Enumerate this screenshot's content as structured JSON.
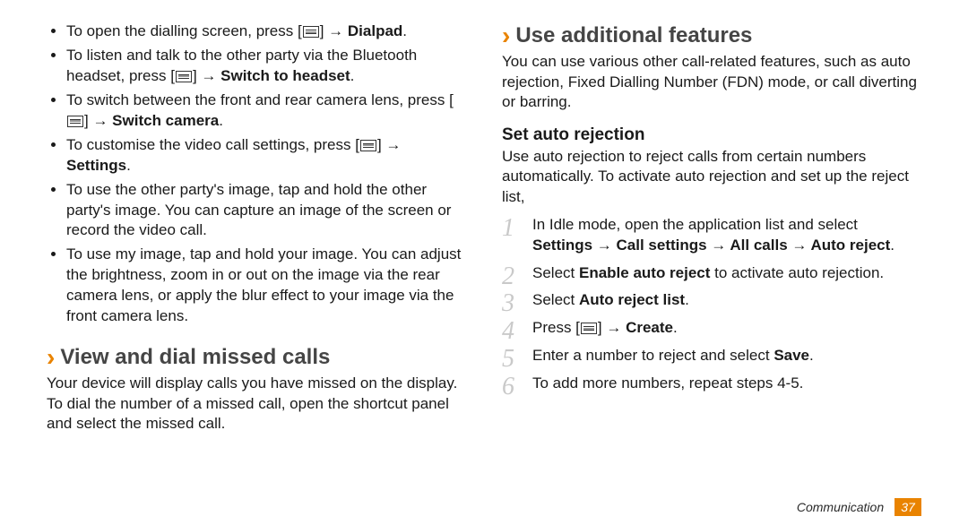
{
  "left": {
    "bullets": [
      {
        "pre": "To open the dialling screen, press [",
        "bold": "Dialpad",
        "post": "."
      },
      {
        "pre": "To listen and talk to the other party via the Bluetooth headset, press [",
        "bold": "Switch to headset",
        "post": "."
      },
      {
        "pre": "To switch between the front and rear camera lens, press [",
        "bold": "Switch camera",
        "post": "."
      },
      {
        "pre": "To customise the video call settings, press [",
        "bold": "Settings",
        "post": "."
      },
      {
        "plain": "To use the other party's image, tap and hold the other party's image. You can capture an image of the screen or record the video call."
      },
      {
        "plain": "To use my image, tap and hold your image. You can adjust the brightness, zoom in or out on the image via the rear camera lens, or apply the blur effect to your image via the front camera lens."
      }
    ],
    "section": "View and dial missed calls",
    "para": "Your device will display calls you have missed on the display. To dial the number of a missed call, open the shortcut panel and select the missed call."
  },
  "right": {
    "section": "Use additional features",
    "intro": "You can use various other call-related features, such as auto rejection, Fixed Dialling Number (FDN) mode, or call diverting or barring.",
    "sub": "Set auto rejection",
    "subintro": "Use auto rejection to reject calls from certain numbers automatically. To activate auto rejection and set up the reject list,",
    "steps": [
      {
        "t1": "In Idle mode, open the application list and select ",
        "b": "Settings → Call settings → All calls → Auto reject",
        "t2": "."
      },
      {
        "t1": "Select ",
        "b": "Enable auto reject",
        "t2": " to activate auto rejection."
      },
      {
        "t1": "Select ",
        "b": "Auto reject list",
        "t2": "."
      },
      {
        "press": true,
        "b": "Create",
        "t2": "."
      },
      {
        "t1": "Enter a number to reject and select ",
        "b": "Save",
        "t2": "."
      },
      {
        "plain": "To add more numbers, repeat steps 4-5."
      }
    ]
  },
  "footer": {
    "section": "Communication",
    "page": "37"
  }
}
